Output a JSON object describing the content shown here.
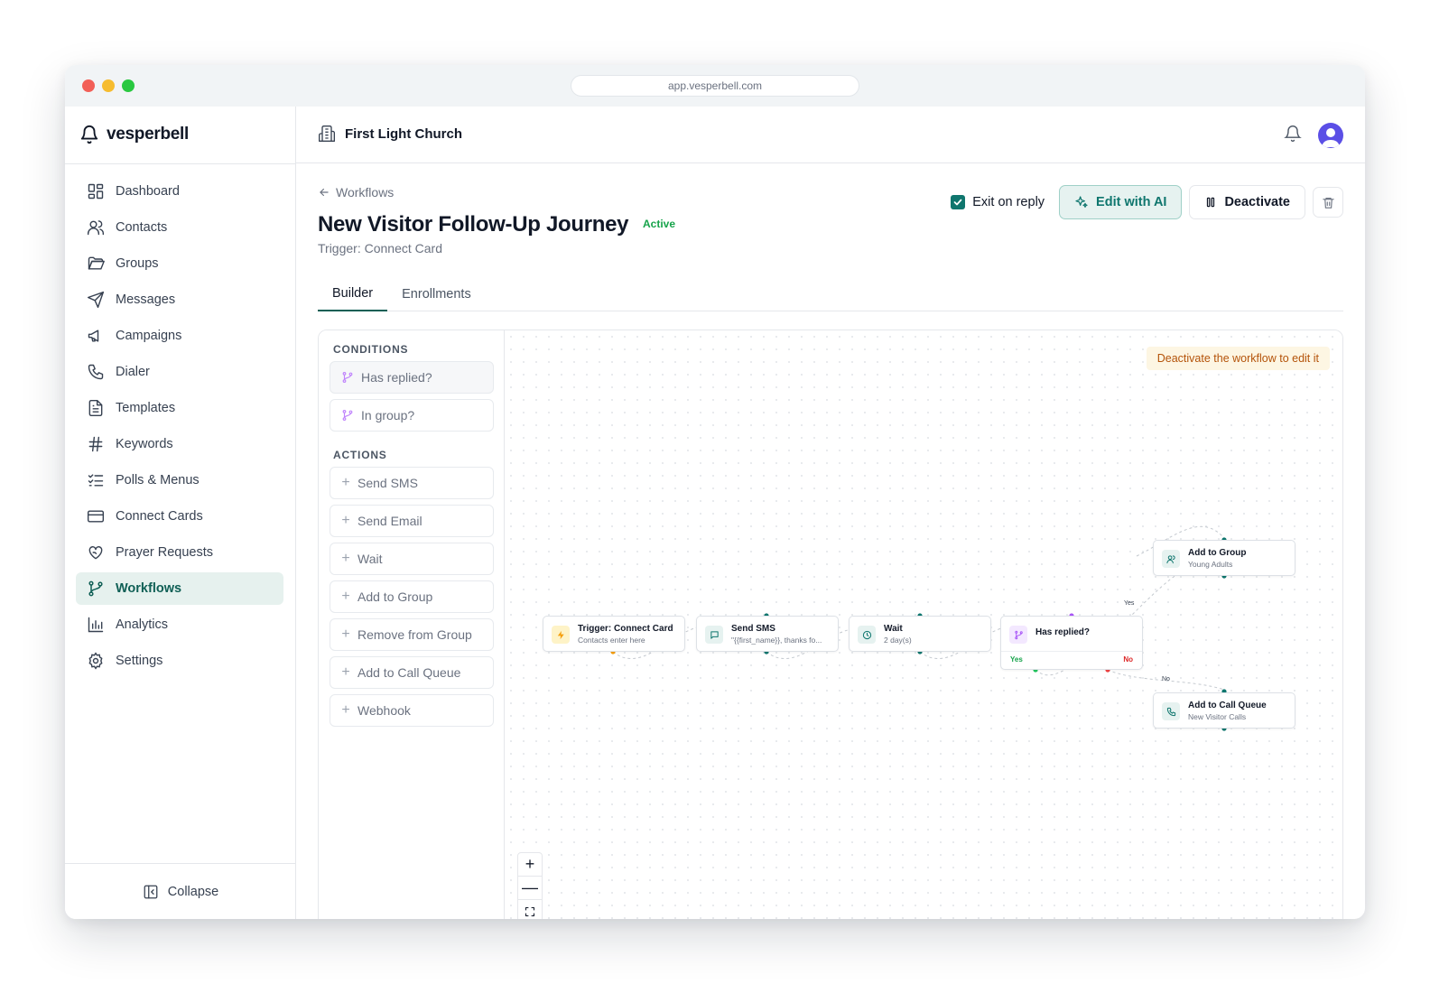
{
  "browser": {
    "url": "app.vesperbell.com"
  },
  "brand": {
    "name": "vesperbell"
  },
  "sidebar": {
    "items": [
      {
        "label": "Dashboard",
        "icon": "dashboard-icon"
      },
      {
        "label": "Contacts",
        "icon": "users-icon"
      },
      {
        "label": "Groups",
        "icon": "folder-icon"
      },
      {
        "label": "Messages",
        "icon": "send-icon"
      },
      {
        "label": "Campaigns",
        "icon": "megaphone-icon"
      },
      {
        "label": "Dialer",
        "icon": "phone-icon"
      },
      {
        "label": "Templates",
        "icon": "document-icon"
      },
      {
        "label": "Keywords",
        "icon": "hash-icon"
      },
      {
        "label": "Polls & Menus",
        "icon": "list-check-icon"
      },
      {
        "label": "Connect Cards",
        "icon": "card-icon"
      },
      {
        "label": "Prayer Requests",
        "icon": "heart-hand-icon"
      },
      {
        "label": "Workflows",
        "icon": "git-branch-icon",
        "active": true
      },
      {
        "label": "Analytics",
        "icon": "bar-chart-icon"
      },
      {
        "label": "Settings",
        "icon": "gear-icon"
      }
    ],
    "collapse_label": "Collapse"
  },
  "header": {
    "organization": "First Light Church"
  },
  "page": {
    "back_label": "Workflows",
    "title": "New Visitor Follow-Up Journey",
    "status": "Active",
    "trigger": "Trigger: Connect Card",
    "exit_on_reply_label": "Exit on reply",
    "exit_on_reply_checked": true,
    "edit_ai_label": "Edit with AI",
    "deactivate_label": "Deactivate"
  },
  "tabs": [
    {
      "label": "Builder",
      "active": true
    },
    {
      "label": "Enrollments",
      "active": false
    }
  ],
  "palette": {
    "conditions_title": "CONDITIONS",
    "conditions": [
      "Has replied?",
      "In group?"
    ],
    "actions_title": "ACTIONS",
    "actions": [
      "Send SMS",
      "Send Email",
      "Wait",
      "Add to Group",
      "Remove from Group",
      "Add to Call Queue",
      "Webhook"
    ]
  },
  "canvas": {
    "notice": "Deactivate the workflow to edit it",
    "nodes": {
      "trigger": {
        "title": "Trigger: Connect Card",
        "subtitle": "Contacts enter here",
        "icon": "lightning-icon"
      },
      "sms": {
        "title": "Send SMS",
        "subtitle": "\"{{first_name}}, thanks fo...",
        "icon": "message-icon"
      },
      "wait": {
        "title": "Wait",
        "subtitle": "2 day(s)",
        "icon": "clock-icon"
      },
      "condition": {
        "title": "Has replied?",
        "yes_label": "Yes",
        "no_label": "No",
        "icon": "git-branch-icon"
      },
      "group": {
        "title": "Add to Group",
        "subtitle": "Young Adults",
        "icon": "users-icon"
      },
      "queue": {
        "title": "Add to Call Queue",
        "subtitle": "New Visitor Calls",
        "icon": "phone-icon"
      }
    },
    "edge_labels": {
      "yes": "Yes",
      "no": "No"
    },
    "zoom": {
      "in": "+",
      "out": "—"
    }
  },
  "colors": {
    "accent": "#0f766e",
    "active_nav_bg": "#e6f1ee",
    "status_green": "#16a34a",
    "notice_text": "#b45309",
    "condition_purple": "#a855f7"
  }
}
